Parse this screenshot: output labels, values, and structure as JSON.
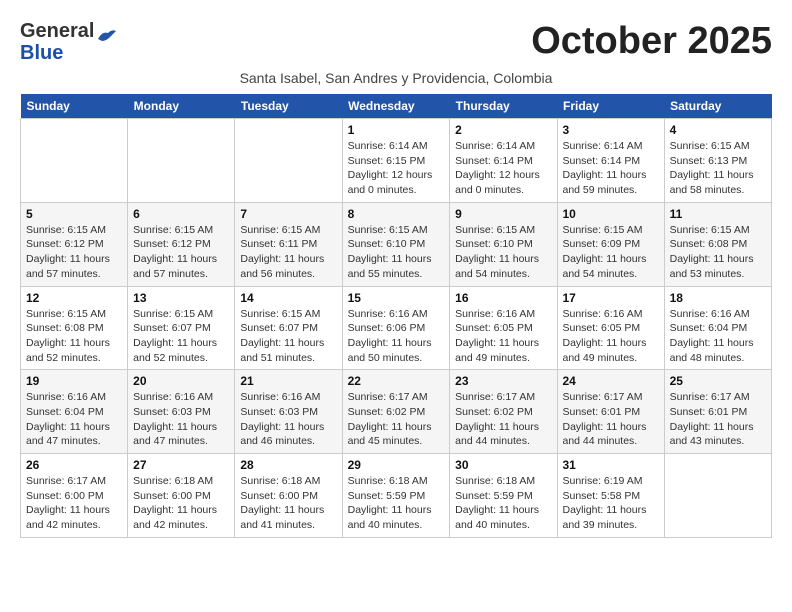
{
  "header": {
    "logo_general": "General",
    "logo_blue": "Blue",
    "month_title": "October 2025",
    "subtitle": "Santa Isabel, San Andres y Providencia, Colombia"
  },
  "weekdays": [
    "Sunday",
    "Monday",
    "Tuesday",
    "Wednesday",
    "Thursday",
    "Friday",
    "Saturday"
  ],
  "weeks": [
    [
      {
        "day": "",
        "sunrise": "",
        "sunset": "",
        "daylight": ""
      },
      {
        "day": "",
        "sunrise": "",
        "sunset": "",
        "daylight": ""
      },
      {
        "day": "",
        "sunrise": "",
        "sunset": "",
        "daylight": ""
      },
      {
        "day": "1",
        "sunrise": "Sunrise: 6:14 AM",
        "sunset": "Sunset: 6:15 PM",
        "daylight": "Daylight: 12 hours and 0 minutes."
      },
      {
        "day": "2",
        "sunrise": "Sunrise: 6:14 AM",
        "sunset": "Sunset: 6:14 PM",
        "daylight": "Daylight: 12 hours and 0 minutes."
      },
      {
        "day": "3",
        "sunrise": "Sunrise: 6:14 AM",
        "sunset": "Sunset: 6:14 PM",
        "daylight": "Daylight: 11 hours and 59 minutes."
      },
      {
        "day": "4",
        "sunrise": "Sunrise: 6:15 AM",
        "sunset": "Sunset: 6:13 PM",
        "daylight": "Daylight: 11 hours and 58 minutes."
      }
    ],
    [
      {
        "day": "5",
        "sunrise": "Sunrise: 6:15 AM",
        "sunset": "Sunset: 6:12 PM",
        "daylight": "Daylight: 11 hours and 57 minutes."
      },
      {
        "day": "6",
        "sunrise": "Sunrise: 6:15 AM",
        "sunset": "Sunset: 6:12 PM",
        "daylight": "Daylight: 11 hours and 57 minutes."
      },
      {
        "day": "7",
        "sunrise": "Sunrise: 6:15 AM",
        "sunset": "Sunset: 6:11 PM",
        "daylight": "Daylight: 11 hours and 56 minutes."
      },
      {
        "day": "8",
        "sunrise": "Sunrise: 6:15 AM",
        "sunset": "Sunset: 6:10 PM",
        "daylight": "Daylight: 11 hours and 55 minutes."
      },
      {
        "day": "9",
        "sunrise": "Sunrise: 6:15 AM",
        "sunset": "Sunset: 6:10 PM",
        "daylight": "Daylight: 11 hours and 54 minutes."
      },
      {
        "day": "10",
        "sunrise": "Sunrise: 6:15 AM",
        "sunset": "Sunset: 6:09 PM",
        "daylight": "Daylight: 11 hours and 54 minutes."
      },
      {
        "day": "11",
        "sunrise": "Sunrise: 6:15 AM",
        "sunset": "Sunset: 6:08 PM",
        "daylight": "Daylight: 11 hours and 53 minutes."
      }
    ],
    [
      {
        "day": "12",
        "sunrise": "Sunrise: 6:15 AM",
        "sunset": "Sunset: 6:08 PM",
        "daylight": "Daylight: 11 hours and 52 minutes."
      },
      {
        "day": "13",
        "sunrise": "Sunrise: 6:15 AM",
        "sunset": "Sunset: 6:07 PM",
        "daylight": "Daylight: 11 hours and 52 minutes."
      },
      {
        "day": "14",
        "sunrise": "Sunrise: 6:15 AM",
        "sunset": "Sunset: 6:07 PM",
        "daylight": "Daylight: 11 hours and 51 minutes."
      },
      {
        "day": "15",
        "sunrise": "Sunrise: 6:16 AM",
        "sunset": "Sunset: 6:06 PM",
        "daylight": "Daylight: 11 hours and 50 minutes."
      },
      {
        "day": "16",
        "sunrise": "Sunrise: 6:16 AM",
        "sunset": "Sunset: 6:05 PM",
        "daylight": "Daylight: 11 hours and 49 minutes."
      },
      {
        "day": "17",
        "sunrise": "Sunrise: 6:16 AM",
        "sunset": "Sunset: 6:05 PM",
        "daylight": "Daylight: 11 hours and 49 minutes."
      },
      {
        "day": "18",
        "sunrise": "Sunrise: 6:16 AM",
        "sunset": "Sunset: 6:04 PM",
        "daylight": "Daylight: 11 hours and 48 minutes."
      }
    ],
    [
      {
        "day": "19",
        "sunrise": "Sunrise: 6:16 AM",
        "sunset": "Sunset: 6:04 PM",
        "daylight": "Daylight: 11 hours and 47 minutes."
      },
      {
        "day": "20",
        "sunrise": "Sunrise: 6:16 AM",
        "sunset": "Sunset: 6:03 PM",
        "daylight": "Daylight: 11 hours and 47 minutes."
      },
      {
        "day": "21",
        "sunrise": "Sunrise: 6:16 AM",
        "sunset": "Sunset: 6:03 PM",
        "daylight": "Daylight: 11 hours and 46 minutes."
      },
      {
        "day": "22",
        "sunrise": "Sunrise: 6:17 AM",
        "sunset": "Sunset: 6:02 PM",
        "daylight": "Daylight: 11 hours and 45 minutes."
      },
      {
        "day": "23",
        "sunrise": "Sunrise: 6:17 AM",
        "sunset": "Sunset: 6:02 PM",
        "daylight": "Daylight: 11 hours and 44 minutes."
      },
      {
        "day": "24",
        "sunrise": "Sunrise: 6:17 AM",
        "sunset": "Sunset: 6:01 PM",
        "daylight": "Daylight: 11 hours and 44 minutes."
      },
      {
        "day": "25",
        "sunrise": "Sunrise: 6:17 AM",
        "sunset": "Sunset: 6:01 PM",
        "daylight": "Daylight: 11 hours and 43 minutes."
      }
    ],
    [
      {
        "day": "26",
        "sunrise": "Sunrise: 6:17 AM",
        "sunset": "Sunset: 6:00 PM",
        "daylight": "Daylight: 11 hours and 42 minutes."
      },
      {
        "day": "27",
        "sunrise": "Sunrise: 6:18 AM",
        "sunset": "Sunset: 6:00 PM",
        "daylight": "Daylight: 11 hours and 42 minutes."
      },
      {
        "day": "28",
        "sunrise": "Sunrise: 6:18 AM",
        "sunset": "Sunset: 6:00 PM",
        "daylight": "Daylight: 11 hours and 41 minutes."
      },
      {
        "day": "29",
        "sunrise": "Sunrise: 6:18 AM",
        "sunset": "Sunset: 5:59 PM",
        "daylight": "Daylight: 11 hours and 40 minutes."
      },
      {
        "day": "30",
        "sunrise": "Sunrise: 6:18 AM",
        "sunset": "Sunset: 5:59 PM",
        "daylight": "Daylight: 11 hours and 40 minutes."
      },
      {
        "day": "31",
        "sunrise": "Sunrise: 6:19 AM",
        "sunset": "Sunset: 5:58 PM",
        "daylight": "Daylight: 11 hours and 39 minutes."
      },
      {
        "day": "",
        "sunrise": "",
        "sunset": "",
        "daylight": ""
      }
    ]
  ]
}
